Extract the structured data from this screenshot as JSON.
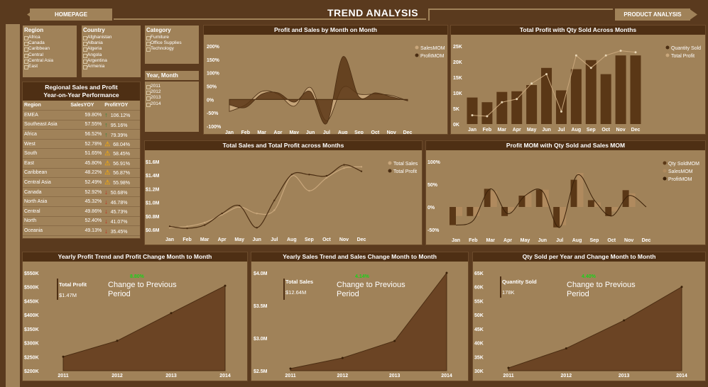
{
  "header": {
    "title": "TREND ANALYSIS",
    "home_label": "HOMEPAGE",
    "product_label": "PRODUCT ANALYSIS"
  },
  "slicers": {
    "region": {
      "title": "Region",
      "items": [
        "Africa",
        "Canada",
        "Caribbean",
        "Central",
        "Central Asia",
        "East"
      ]
    },
    "country": {
      "title": "Country",
      "items": [
        "Afghanistan",
        "Albania",
        "Algeria",
        "Angola",
        "Argentina",
        "Armenia"
      ]
    },
    "category": {
      "title": "Category",
      "items": [
        "Furniture",
        "Office Supplies",
        "Technology"
      ]
    },
    "yearmonth": {
      "title": "Year, Month",
      "items": [
        "2011",
        "2012",
        "2013",
        "2014"
      ]
    }
  },
  "yoy_table": {
    "title1": "Regional Sales and Profit",
    "title2": "Year-on-Year Performance",
    "headers": [
      "Region",
      "SalesYOY",
      "ProfitYOY"
    ],
    "rows": [
      {
        "region": "EMEA",
        "sales": "59.80%",
        "profit": "106.12%",
        "icon": "up"
      },
      {
        "region": "Southeast Asia",
        "sales": "57.55%",
        "profit": "95.16%",
        "icon": "up"
      },
      {
        "region": "Africa",
        "sales": "56.52%",
        "profit": "79.39%",
        "icon": "up"
      },
      {
        "region": "West",
        "sales": "52.78%",
        "profit": "68.04%",
        "icon": "warn"
      },
      {
        "region": "South",
        "sales": "51.65%",
        "profit": "58.45%",
        "icon": "warn"
      },
      {
        "region": "East",
        "sales": "45.80%",
        "profit": "56.91%",
        "icon": "warn"
      },
      {
        "region": "Caribbean",
        "sales": "48.22%",
        "profit": "56.87%",
        "icon": "warn"
      },
      {
        "region": "Central Asia",
        "sales": "52.49%",
        "profit": "55.98%",
        "icon": "warn"
      },
      {
        "region": "Canada",
        "sales": "52.92%",
        "profit": "50.68%",
        "icon": "down"
      },
      {
        "region": "North Asia",
        "sales": "45.32%",
        "profit": "46.78%",
        "icon": "down"
      },
      {
        "region": "Central",
        "sales": "49.86%",
        "profit": "45.73%",
        "icon": "down"
      },
      {
        "region": "North",
        "sales": "52.40%",
        "profit": "41.07%",
        "icon": "down"
      },
      {
        "region": "Oceania",
        "sales": "49.13%",
        "profit": "35.45%",
        "icon": "down"
      }
    ]
  },
  "colors": {
    "bg": "#5a3a1e",
    "panel": "#a08259",
    "title_bar": "#4e2f14",
    "dark": "#5a3716",
    "light": "#c9a77c",
    "up": "#2e8b3f",
    "warn": "#e0a020",
    "down": "#c0301e"
  },
  "months": [
    "Jan",
    "Feb",
    "Mar",
    "Apr",
    "May",
    "Jun",
    "Jul",
    "Aug",
    "Sep",
    "Oct",
    "Nov",
    "Dec"
  ],
  "chart_data": [
    {
      "id": "c1",
      "type": "area",
      "title": "Profit and Sales by Month on Month",
      "y_ticks": [
        "200%",
        "150%",
        "100%",
        "50%",
        "0%",
        "-50%",
        "-100%"
      ],
      "ylim": [
        -100,
        200
      ],
      "series": [
        {
          "name": "SalesMOM",
          "values": [
            -20,
            -30,
            20,
            25,
            -10,
            30,
            -90,
            160,
            10,
            25,
            10,
            -5
          ]
        },
        {
          "name": "ProfitMOM",
          "values": [
            -45,
            -20,
            30,
            20,
            -25,
            45,
            -80,
            45,
            20,
            20,
            15,
            -5
          ]
        }
      ]
    },
    {
      "id": "c2",
      "type": "bar",
      "title": "Total Profit with Qty Sold Across Months",
      "y_ticks": [
        "25K",
        "20K",
        "15K",
        "10K",
        "5K",
        "0K"
      ],
      "ylim": [
        0,
        25000
      ],
      "series": [
        {
          "name": "Quantity Sold",
          "values": [
            8500,
            7000,
            10300,
            10500,
            12500,
            18000,
            10800,
            17600,
            20500,
            16000,
            22000,
            22000
          ]
        },
        {
          "name": "Total Profit",
          "values": [
            2800,
            2500,
            7000,
            8000,
            13000,
            16000,
            4000,
            22000,
            18000,
            22000,
            23500,
            23000
          ]
        }
      ]
    },
    {
      "id": "c3",
      "type": "line",
      "title": "Total Sales and Total Profit across Months",
      "y_ticks": [
        "$1.6M",
        "$1.4M",
        "$1.2M",
        "$1.0M",
        "$0.8M",
        "$0.6M"
      ],
      "ylim": [
        0.55,
        1.6
      ],
      "series": [
        {
          "name": "Total Sales",
          "values": [
            0.58,
            0.6,
            0.66,
            0.78,
            0.9,
            0.8,
            0.85,
            1.38,
            1.15,
            1.35,
            1.5,
            1.52
          ]
        },
        {
          "name": "Total Profit",
          "values": [
            0.6,
            0.57,
            0.62,
            0.8,
            0.92,
            0.58,
            1.0,
            1.4,
            1.4,
            1.38,
            1.55,
            1.45
          ]
        }
      ]
    },
    {
      "id": "c4",
      "type": "bar",
      "title": "Profit MOM with Qty Sold and Sales MOM",
      "y_ticks": [
        "100%",
        "50%",
        "0%",
        "-50%"
      ],
      "ylim": [
        -50,
        100
      ],
      "series": [
        {
          "name": "Qty SoldMOM",
          "values": [
            -40,
            -20,
            40,
            -20,
            25,
            38,
            -45,
            60,
            15,
            -20,
            37,
            0
          ]
        },
        {
          "name": "SalesMOM",
          "values": [
            -20,
            -20,
            35,
            -10,
            30,
            38,
            -40,
            75,
            10,
            -10,
            30,
            0
          ]
        },
        {
          "name": "ProfitMOM",
          "values": [
            -40,
            -30,
            40,
            -15,
            25,
            35,
            -45,
            70,
            15,
            -20,
            25,
            0
          ]
        }
      ]
    },
    {
      "id": "c5",
      "type": "area",
      "title": "Yearly Profit Trend and Profit Change Month to Month",
      "categories": [
        "2011",
        "2012",
        "2013",
        "2014"
      ],
      "y_ticks": [
        "$550K",
        "$500K",
        "$450K",
        "$400K",
        "$350K",
        "$300K",
        "$250K",
        "$200K"
      ],
      "ylim": [
        200,
        550
      ],
      "values": [
        250,
        307,
        406,
        504
      ]
    },
    {
      "id": "c6",
      "type": "area",
      "title": "Yearly Sales Trend and Sales Change Month to Month",
      "categories": [
        "2011",
        "2012",
        "2013",
        "2014"
      ],
      "y_ticks": [
        "$4.0M",
        "$3.5M",
        "$3.0M",
        "$2.5M"
      ],
      "ylim": [
        2.0,
        4.3
      ],
      "values": [
        2.05,
        2.3,
        2.7,
        4.3
      ]
    },
    {
      "id": "c7",
      "type": "area",
      "title": "Qty Sold per Year and Change Month to Month",
      "categories": [
        "2011",
        "2012",
        "2013",
        "2014"
      ],
      "y_ticks": [
        "65K",
        "60K",
        "55K",
        "50K",
        "45K",
        "40K",
        "35K",
        "30K"
      ],
      "ylim": [
        30,
        65
      ],
      "values": [
        31,
        38,
        48,
        60
      ]
    }
  ],
  "kpis": [
    {
      "label": "Total Profit",
      "value": "$1.47M",
      "pct": "8.80%",
      "note1": "Change to Previous",
      "note2": "Period"
    },
    {
      "label": "Total Sales",
      "value": "$12.64M",
      "pct": "4.14%",
      "note1": "Change to Previous",
      "note2": "Period"
    },
    {
      "label": "Quantity Sold",
      "value": "178K",
      "pct": "4.40%",
      "note1": "Change to Previous",
      "note2": "Period"
    }
  ]
}
